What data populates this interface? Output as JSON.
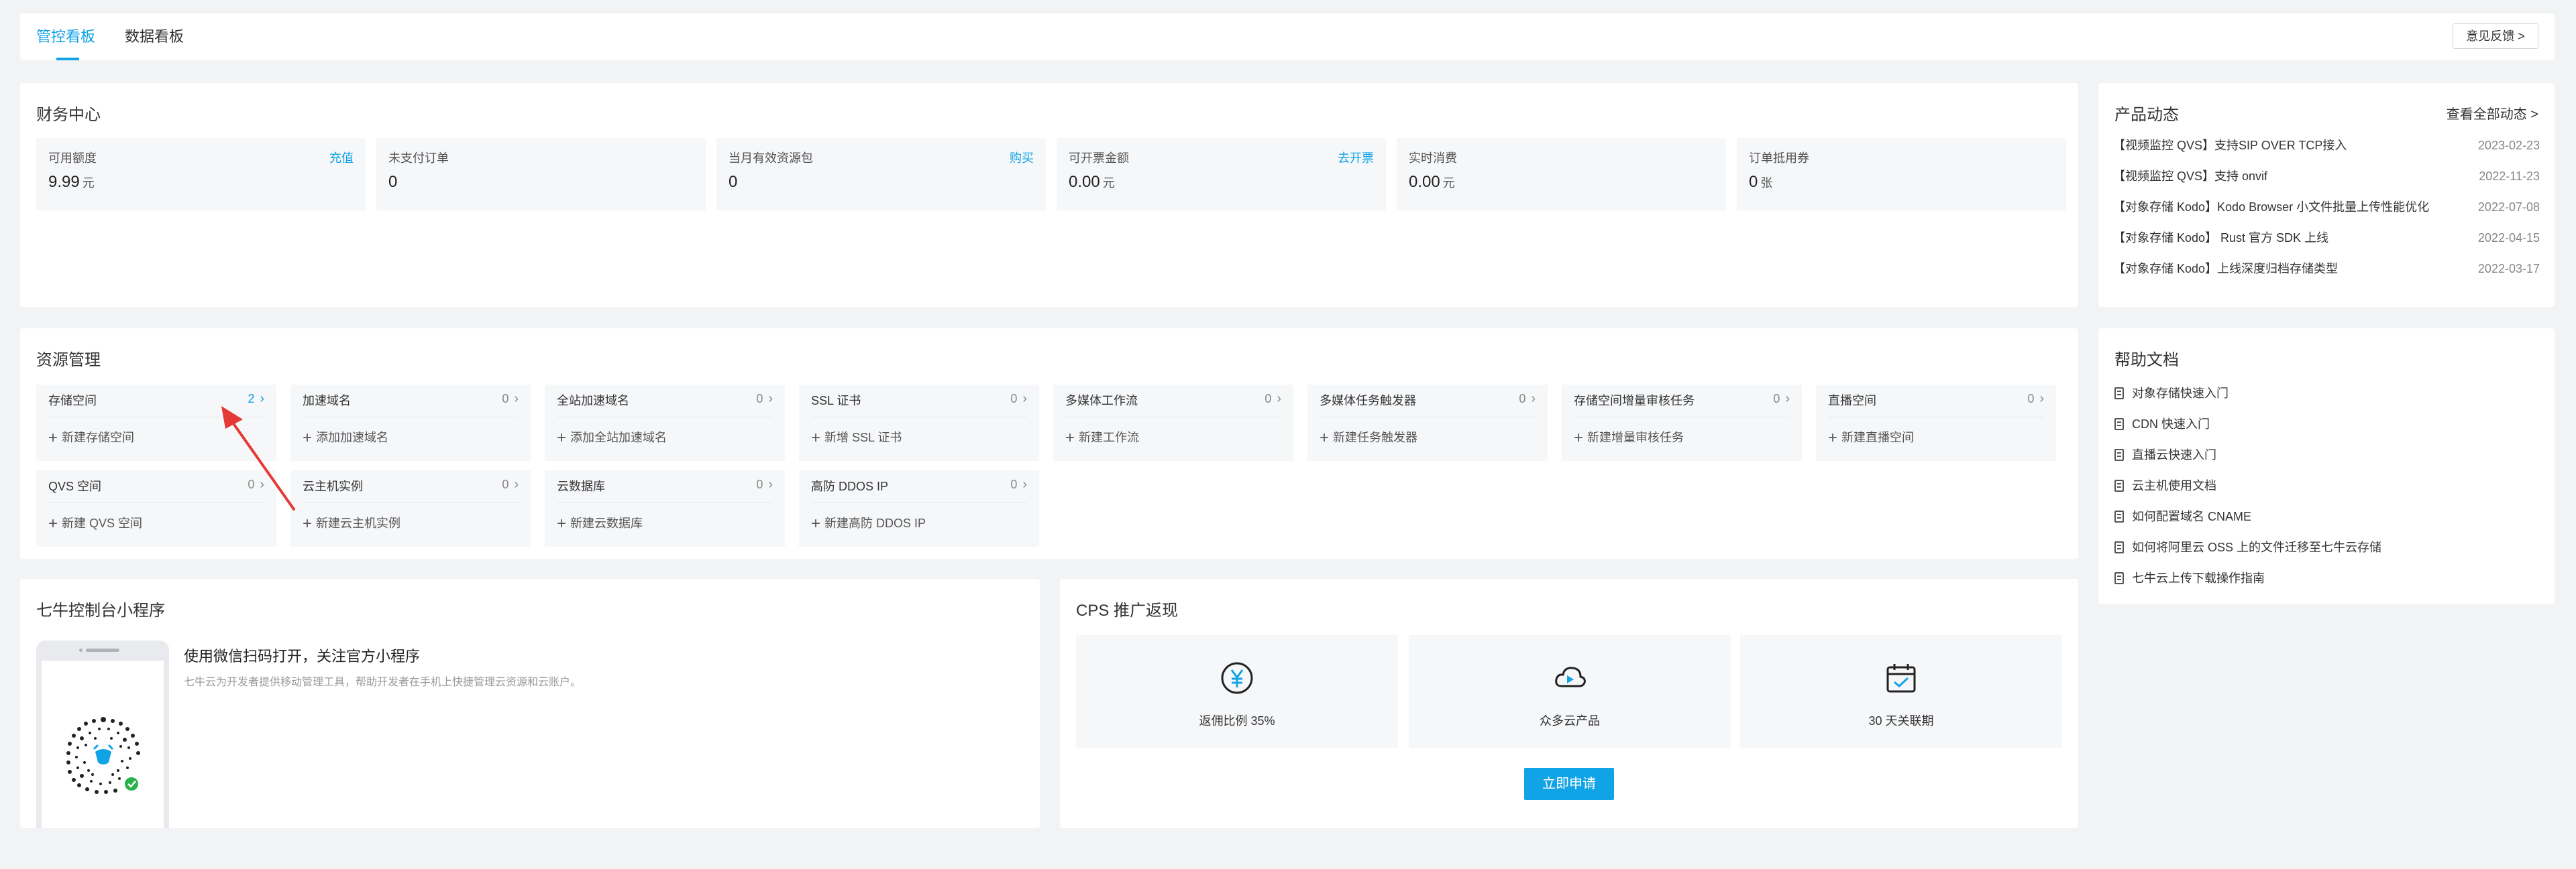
{
  "tabs": [
    {
      "label": "管控看板",
      "active": true
    },
    {
      "label": "数据看板",
      "active": false
    }
  ],
  "feedback_label": "意见反馈 >",
  "finance": {
    "title": "财务中心",
    "items": [
      {
        "label": "可用额度",
        "action": "充值",
        "value": "9.99",
        "unit": "元"
      },
      {
        "label": "未支付订单",
        "action": "",
        "value": "0",
        "unit": ""
      },
      {
        "label": "当月有效资源包",
        "action": "购买",
        "value": "0",
        "unit": ""
      },
      {
        "label": "可开票金额",
        "action": "去开票",
        "value": "0.00",
        "unit": "元"
      },
      {
        "label": "实时消费",
        "action": "",
        "value": "0.00",
        "unit": "元"
      },
      {
        "label": "订单抵用券",
        "action": "",
        "value": "0",
        "unit": "张"
      }
    ]
  },
  "news": {
    "title": "产品动态",
    "more_label": "查看全部动态 >",
    "items": [
      {
        "text": "【视频监控 QVS】支持SIP OVER TCP接入",
        "date": "2023-02-23"
      },
      {
        "text": "【视频监控 QVS】支持 onvif",
        "date": "2022-11-23"
      },
      {
        "text": "【对象存储 Kodo】Kodo Browser 小文件批量上传性能优化",
        "date": "2022-07-08"
      },
      {
        "text": "【对象存储 Kodo】 Rust 官方 SDK 上线",
        "date": "2022-04-15"
      },
      {
        "text": "【对象存储 Kodo】上线深度归档存储类型",
        "date": "2022-03-17"
      }
    ]
  },
  "resources": {
    "title": "资源管理",
    "items": [
      {
        "name": "存储空间",
        "count": "2",
        "add": "新建存储空间"
      },
      {
        "name": "加速域名",
        "count": "0",
        "add": "添加加速域名"
      },
      {
        "name": "全站加速域名",
        "count": "0",
        "add": "添加全站加速域名"
      },
      {
        "name": "SSL 证书",
        "count": "0",
        "add": "新增 SSL 证书"
      },
      {
        "name": "多媒体工作流",
        "count": "0",
        "add": "新建工作流"
      },
      {
        "name": "多媒体任务触发器",
        "count": "0",
        "add": "新建任务触发器"
      },
      {
        "name": "存储空间增量审核任务",
        "count": "0",
        "add": "新建增量审核任务"
      },
      {
        "name": "直播空间",
        "count": "0",
        "add": "新建直播空间"
      },
      {
        "name": "QVS 空间",
        "count": "0",
        "add": "新建 QVS 空间"
      },
      {
        "name": "云主机实例",
        "count": "0",
        "add": "新建云主机实例"
      },
      {
        "name": "云数据库",
        "count": "0",
        "add": "新建云数据库"
      },
      {
        "name": "高防 DDOS IP",
        "count": "0",
        "add": "新建高防 DDOS IP"
      }
    ]
  },
  "help": {
    "title": "帮助文档",
    "items": [
      "对象存储快速入门",
      "CDN 快速入门",
      "直播云快速入门",
      "云主机使用文档",
      "如何配置域名 CNAME",
      "如何将阿里云 OSS 上的文件迁移至七牛云存储",
      "七牛云上传下载操作指南"
    ]
  },
  "mini": {
    "title": "七牛控制台小程序",
    "heading": "使用微信扫码打开，关注官方小程序",
    "desc": "七牛云为开发者提供移动管理工具，帮助开发者在手机上快捷管理云资源和云账户。"
  },
  "cps": {
    "title": "CPS 推广返现",
    "items": [
      {
        "icon": "yuan-icon",
        "label": "返佣比例 35%"
      },
      {
        "icon": "cloud-play-icon",
        "label": "众多云产品"
      },
      {
        "icon": "calendar-check-icon",
        "label": "30 天关联期"
      }
    ],
    "apply_label": "立即申请"
  },
  "colors": {
    "accent": "#10a3e6",
    "background": "#f2f3f5",
    "box": "#f6f7f9"
  }
}
